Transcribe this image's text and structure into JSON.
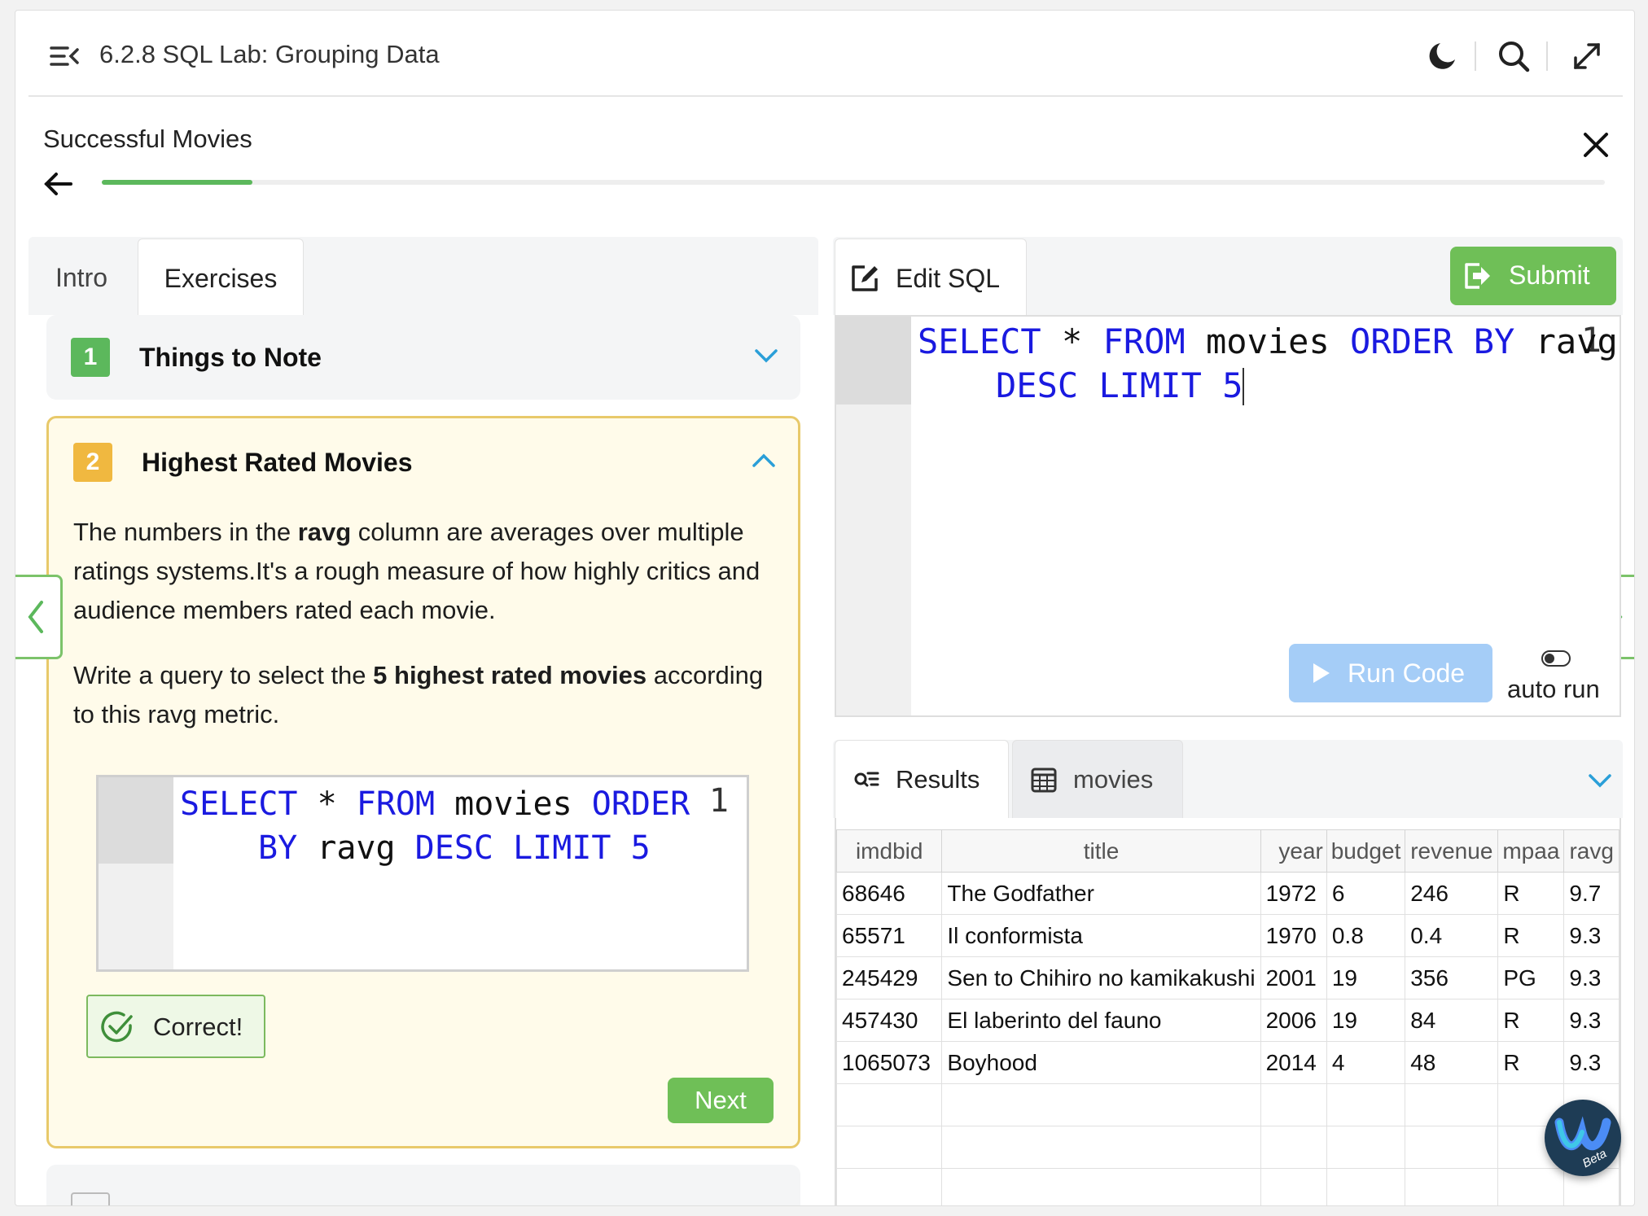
{
  "header": {
    "title": "6.2.8 SQL Lab: Grouping Data",
    "icons": [
      "menu-collapse-icon",
      "moon-icon",
      "search-icon",
      "expand-icon"
    ]
  },
  "step": {
    "title": "Successful Movies",
    "progress_fraction": 0.1
  },
  "left_tabs": [
    "Intro",
    "Exercises"
  ],
  "exercises": [
    {
      "number": "1",
      "title": "Things to Note",
      "badge_color": "#5cb85c",
      "expanded": false
    },
    {
      "number": "2",
      "title": "Highest Rated Movies",
      "badge_color": "#f0b840",
      "expanded": true,
      "para1_a": "The numbers in the ",
      "para1_b": "ravg",
      "para1_c": " column are averages over multiple ratings systems.It's a rough measure of how highly critics and audience members rated each movie.",
      "para2_a": "Write a query to select the ",
      "para2_b": "5 highest rated movies",
      "para2_c": " according to this ravg metric.",
      "code_line_number": "1",
      "code_line1": [
        "SELECT",
        " * ",
        "FROM",
        " movies ",
        "ORDER"
      ],
      "code_line2": [
        "BY",
        " ravg ",
        "DESC",
        " ",
        "LIMIT",
        " ",
        "5"
      ],
      "status": "Correct!",
      "next_label": "Next"
    }
  ],
  "editor": {
    "tab_label": "Edit SQL",
    "submit_label": "Submit",
    "line_number": "1",
    "line1": [
      "SELECT",
      " * ",
      "FROM",
      " movies ",
      "ORDER",
      " ",
      "BY",
      " ravg"
    ],
    "line2": [
      "DESC",
      " ",
      "LIMIT",
      " ",
      "5"
    ],
    "run_label": "Run Code",
    "autorun_label": "auto run",
    "autorun_on": false
  },
  "results": {
    "tabs": [
      "Results",
      "movies"
    ],
    "columns": [
      "imdbid",
      "title",
      "year",
      "budget",
      "revenue",
      "mpaa",
      "ravg"
    ],
    "rows": [
      [
        "68646",
        "The Godfather",
        "1972",
        "6",
        "246",
        "R",
        "9.7"
      ],
      [
        "65571",
        "Il conformista",
        "1970",
        "0.8",
        "0.4",
        "R",
        "9.3"
      ],
      [
        "245429",
        "Sen to Chihiro no kamikakushi",
        "2001",
        "19",
        "356",
        "PG",
        "9.3"
      ],
      [
        "457430",
        "El laberinto del fauno",
        "2006",
        "19",
        "84",
        "R",
        "9.3"
      ],
      [
        "1065073",
        "Boyhood",
        "2014",
        "4",
        "48",
        "R",
        "9.3"
      ]
    ],
    "empty_rows": 3
  },
  "assistant": {
    "badge_text": "Beta"
  },
  "colors": {
    "accent_green": "#6fbf57",
    "keyword_blue": "#1a1ae0",
    "active_border": "#e8c96a",
    "run_button": "#a5cdf7"
  }
}
